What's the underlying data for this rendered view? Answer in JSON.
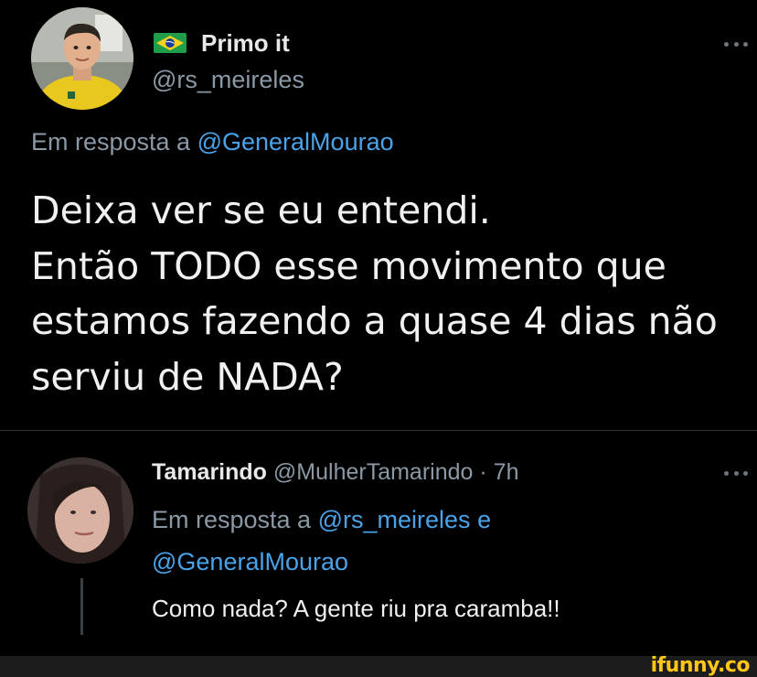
{
  "main_tweet": {
    "flag_icon": "brazil-flag-icon",
    "display_name": "Primo it",
    "handle": "@rs_meireles",
    "reply_prefix": "Em resposta a",
    "reply_to": "@GeneralMourao",
    "text_lines": [
      "Deixa ver se eu entendi.",
      "Então TODO esse movimento que",
      "estamos fazendo a quase 4 dias não",
      "serviu de NADA?"
    ]
  },
  "reply_tweet": {
    "display_name": "Tamarindo",
    "handle": "@MulherTamarindo",
    "separator": "·",
    "time": "7h",
    "reply_prefix": "Em resposta a",
    "reply_to_1": "@rs_meireles",
    "reply_joiner": "e",
    "reply_to_2": "@GeneralMourao",
    "text": "Como nada? A gente riu pra caramba!!"
  },
  "watermark": "ifunny.co",
  "colors": {
    "background": "#000000",
    "text_primary": "#e7e9ea",
    "text_secondary": "#8b98a5",
    "mention": "#4aa3e8",
    "divider": "#2f3336",
    "watermark": "#ffc619"
  }
}
